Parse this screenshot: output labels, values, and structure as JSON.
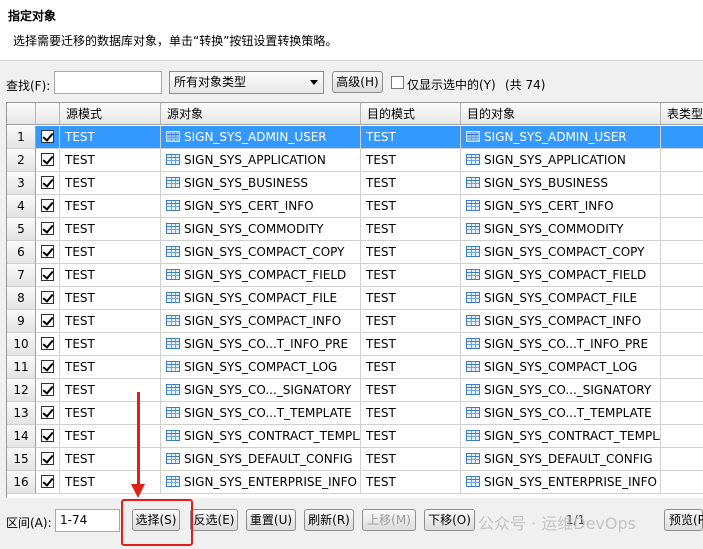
{
  "header": {
    "title": "指定对象",
    "description": "选择需要迁移的数据库对象，单击“转换”按钮设置转换策略。"
  },
  "toolbar": {
    "find_label": "查找(F):",
    "find_value": "",
    "type_select": "所有对象类型",
    "advanced_label": "高级(H)",
    "only_selected_label": "仅显示选中的(Y)",
    "count_label": "(共 74)"
  },
  "grid": {
    "columns": [
      "源模式",
      "源对象",
      "目的模式",
      "目的对象",
      "表类型"
    ],
    "rows": [
      {
        "num": "1",
        "src_mode": "TEST",
        "src_obj": "SIGN_SYS_ADMIN_USER",
        "dst_mode": "TEST",
        "dst_obj": "SIGN_SYS_ADMIN_USER"
      },
      {
        "num": "2",
        "src_mode": "TEST",
        "src_obj": "SIGN_SYS_APPLICATION",
        "dst_mode": "TEST",
        "dst_obj": "SIGN_SYS_APPLICATION"
      },
      {
        "num": "3",
        "src_mode": "TEST",
        "src_obj": "SIGN_SYS_BUSINESS",
        "dst_mode": "TEST",
        "dst_obj": "SIGN_SYS_BUSINESS"
      },
      {
        "num": "4",
        "src_mode": "TEST",
        "src_obj": "SIGN_SYS_CERT_INFO",
        "dst_mode": "TEST",
        "dst_obj": "SIGN_SYS_CERT_INFO"
      },
      {
        "num": "5",
        "src_mode": "TEST",
        "src_obj": "SIGN_SYS_COMMODITY",
        "dst_mode": "TEST",
        "dst_obj": "SIGN_SYS_COMMODITY"
      },
      {
        "num": "6",
        "src_mode": "TEST",
        "src_obj": "SIGN_SYS_COMPACT_COPY",
        "dst_mode": "TEST",
        "dst_obj": "SIGN_SYS_COMPACT_COPY"
      },
      {
        "num": "7",
        "src_mode": "TEST",
        "src_obj": "SIGN_SYS_COMPACT_FIELD",
        "dst_mode": "TEST",
        "dst_obj": "SIGN_SYS_COMPACT_FIELD"
      },
      {
        "num": "8",
        "src_mode": "TEST",
        "src_obj": "SIGN_SYS_COMPACT_FILE",
        "dst_mode": "TEST",
        "dst_obj": "SIGN_SYS_COMPACT_FILE"
      },
      {
        "num": "9",
        "src_mode": "TEST",
        "src_obj": "SIGN_SYS_COMPACT_INFO",
        "dst_mode": "TEST",
        "dst_obj": "SIGN_SYS_COMPACT_INFO"
      },
      {
        "num": "10",
        "src_mode": "TEST",
        "src_obj": "SIGN_SYS_CO...T_INFO_PRE",
        "dst_mode": "TEST",
        "dst_obj": "SIGN_SYS_CO...T_INFO_PRE"
      },
      {
        "num": "11",
        "src_mode": "TEST",
        "src_obj": "SIGN_SYS_COMPACT_LOG",
        "dst_mode": "TEST",
        "dst_obj": "SIGN_SYS_COMPACT_LOG"
      },
      {
        "num": "12",
        "src_mode": "TEST",
        "src_obj": "SIGN_SYS_CO..._SIGNATORY",
        "dst_mode": "TEST",
        "dst_obj": "SIGN_SYS_CO..._SIGNATORY"
      },
      {
        "num": "13",
        "src_mode": "TEST",
        "src_obj": "SIGN_SYS_CO...T_TEMPLATE",
        "dst_mode": "TEST",
        "dst_obj": "SIGN_SYS_CO...T_TEMPLATE"
      },
      {
        "num": "14",
        "src_mode": "TEST",
        "src_obj": "SIGN_SYS_CONTRACT_TEMPLA",
        "dst_mode": "TEST",
        "dst_obj": "SIGN_SYS_CONTRACT_TEMPLA"
      },
      {
        "num": "15",
        "src_mode": "TEST",
        "src_obj": "SIGN_SYS_DEFAULT_CONFIG",
        "dst_mode": "TEST",
        "dst_obj": "SIGN_SYS_DEFAULT_CONFIG"
      },
      {
        "num": "16",
        "src_mode": "TEST",
        "src_obj": "SIGN_SYS_ENTERPRISE_INFO",
        "dst_mode": "TEST",
        "dst_obj": "SIGN_SYS_ENTERPRISE_INFO"
      }
    ]
  },
  "bottom": {
    "range_label": "区间(A):",
    "range_value": "1-74",
    "select_label": "选择(S)",
    "invert_label": "反选(E)",
    "reset_label": "重置(U)",
    "refresh_label": "刷新(R)",
    "move_up_label": "上移(M)",
    "move_down_label": "下移(O)",
    "page_info": "1/1",
    "preview_label": "预览(P"
  },
  "watermark": "公众号 · 运维DevOps",
  "colors": {
    "selection": "#3399ff",
    "annotation": "#e0201a"
  }
}
